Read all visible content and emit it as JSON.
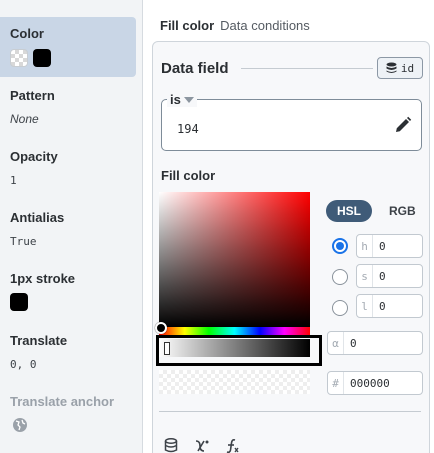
{
  "sidebar": {
    "items": [
      {
        "label": "Color",
        "active": true
      },
      {
        "label": "Pattern",
        "value": "None"
      },
      {
        "label": "Opacity",
        "value": "1"
      },
      {
        "label": "Antialias",
        "value": "True"
      },
      {
        "label": "1px stroke"
      },
      {
        "label": "Translate",
        "value": "0, 0"
      },
      {
        "label": "Translate anchor"
      }
    ],
    "icons": {
      "color_swatches": [
        "checkerboard-icon",
        "black-swatch-icon"
      ],
      "stroke_swatch": "black-swatch-icon",
      "anchor": "globe-icon"
    }
  },
  "tabs": {
    "active": "Fill color",
    "other": "Data conditions"
  },
  "data_field": {
    "title": "Data field",
    "id_button": "id",
    "operator": "is",
    "value": "194"
  },
  "fill_color": {
    "title": "Fill color",
    "modes": [
      "HSL",
      "RGB"
    ],
    "selected_mode": "HSL",
    "channels": [
      {
        "key": "h",
        "value": "0",
        "selected": true
      },
      {
        "key": "s",
        "value": "0",
        "selected": false
      },
      {
        "key": "l",
        "value": "0",
        "selected": false
      }
    ],
    "alpha": {
      "key": "α",
      "value": "0"
    },
    "hex": {
      "key": "#",
      "value": "000000"
    }
  },
  "colors": {
    "accent": "#1a73e8",
    "mode_active_bg": "#3f5b78",
    "sidebar_active": "#c9d6e6"
  }
}
